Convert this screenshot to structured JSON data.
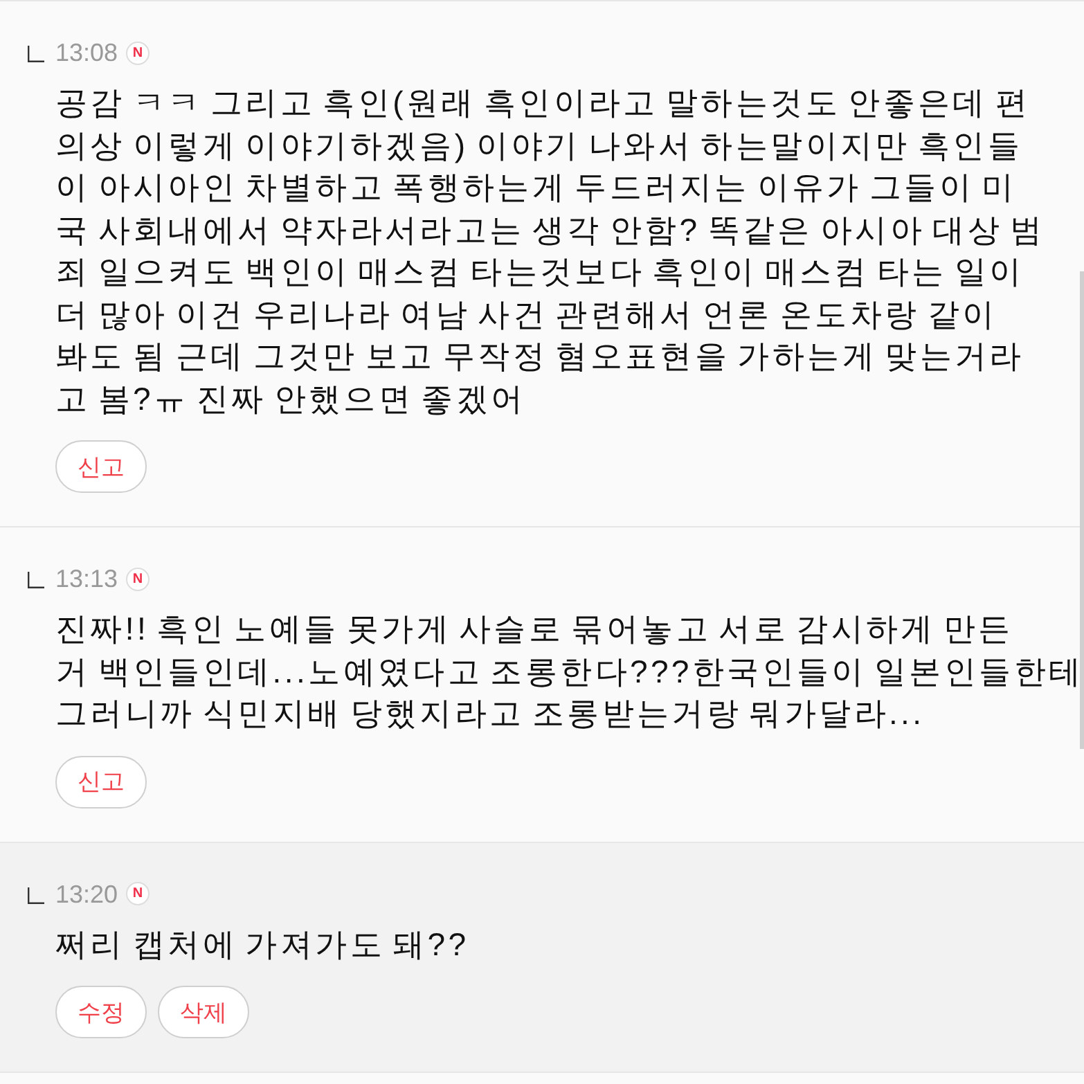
{
  "comments": [
    {
      "kind": "other",
      "time": "13:08",
      "badge": "N",
      "text": "공감 ㅋㅋ 그리고 흑인(원래 흑인이라고 말하는것도 안좋은데 편\n의상 이렇게 이야기하겠음) 이야기 나와서 하는말이지만 흑인들\n이 아시아인 차별하고 폭행하는게 두드러지는 이유가 그들이 미\n국 사회내에서 약자라서라고는 생각 안함? 똑같은 아시아 대상 범\n죄 일으켜도 백인이 매스컴 타는것보다 흑인이 매스컴 타는 일이\n더 많아 이건 우리나라 여남 사건 관련해서 언론 온도차랑 같이\n봐도 됨 근데 그것만 보고 무작정 혐오표현을 가하는게 맞는거라\n고 봄?ㅠ 진짜 안했으면 좋겠어",
      "buttons": [
        "신고"
      ]
    },
    {
      "kind": "other",
      "time": "13:13",
      "badge": "N",
      "text": "진짜!! 흑인 노예들 못가게 사슬로 묶어놓고 서로 감시하게 만든\n거 백인들인데...노예였다고 조롱한다???한국인들이 일본인들한테\n그러니까 식민지배 당했지라고 조롱받는거랑 뭐가달라...",
      "buttons": [
        "신고"
      ]
    },
    {
      "kind": "own",
      "time": "13:20",
      "badge": "N",
      "text": "쩌리 캡처에 가져가도 돼??",
      "buttons": [
        "수정",
        "삭제"
      ]
    }
  ]
}
